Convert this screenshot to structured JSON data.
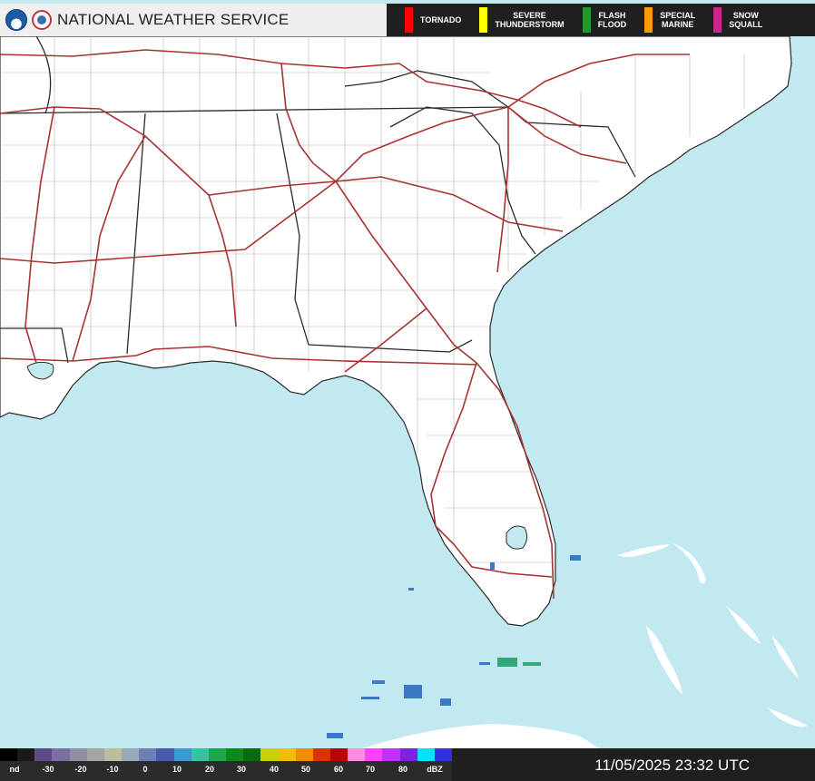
{
  "header": {
    "agency": "NATIONAL WEATHER SERVICE",
    "noaa_logo": "noaa-logo",
    "nws_logo": "nws-logo"
  },
  "warnings_legend": [
    {
      "label": "TORNADO",
      "color": "#ff0000"
    },
    {
      "label": "SEVERE\nTHUNDERSTORM",
      "color": "#ffff00"
    },
    {
      "label": "FLASH\nFLOOD",
      "color": "#1f9a28"
    },
    {
      "label": "SPECIAL\nMARINE",
      "color": "#ff9900"
    },
    {
      "label": "SNOW\nSQUALL",
      "color": "#c8288c"
    }
  ],
  "reflectivity_scale": {
    "labels": [
      "nd",
      "-30",
      "-20",
      "-10",
      "0",
      "10",
      "20",
      "30",
      "40",
      "50",
      "60",
      "70",
      "80",
      "dBZ"
    ],
    "colors": [
      "#000000",
      "#1a1a1a",
      "#5e4b8b",
      "#7b6ea3",
      "#8e8ea0",
      "#a5a5a5",
      "#bcbc9e",
      "#9aa8b8",
      "#6e7eb8",
      "#4a5bab",
      "#3a9ad0",
      "#34c4a0",
      "#1aa84a",
      "#0e8a1a",
      "#0a6a10",
      "#c8d200",
      "#f0c000",
      "#f08c00",
      "#e03000",
      "#c00000",
      "#ff8ce0",
      "#ff40ff",
      "#c030ff",
      "#8020e0",
      "#00e0ff",
      "#3030e0"
    ]
  },
  "timestamp": "11/05/2025 23:32 UTC",
  "colors": {
    "ocean": "#c2e8f0",
    "land": "#ffffff",
    "state_border": "#2a2a2a",
    "county_border": "#b5b5b5",
    "highway": "#a83232",
    "radar_echo": "#3a78c8"
  }
}
